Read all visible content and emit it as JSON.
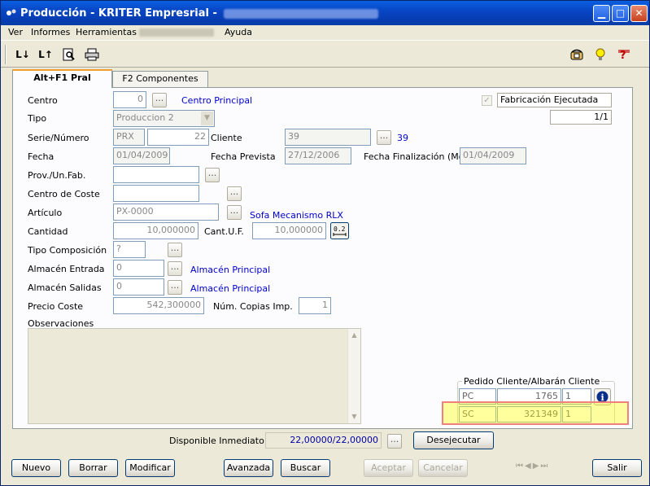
{
  "window": {
    "title": "Producción - KRITER Empresrial  -"
  },
  "menu": [
    "Ver",
    "Informes",
    "Herramientas",
    "Ayuda"
  ],
  "tabs": [
    {
      "label": "Alt+F1 Pral"
    },
    {
      "label": "F2 Componentes"
    }
  ],
  "toolbar": {
    "sort_asc": "L↓",
    "sort_desc": "L↑"
  },
  "form": {
    "centro": {
      "label": "Centro",
      "value": "0",
      "link": "Centro Principal"
    },
    "tipo": {
      "label": "Tipo",
      "value": "Produccion 2"
    },
    "fabricacion": {
      "label": "Fabricación Ejecutada",
      "counter": "1/1"
    },
    "serie": {
      "label": "Serie/Número",
      "serie": "PRX",
      "numero": "22"
    },
    "cliente": {
      "label": "Cliente",
      "value": "39",
      "link": "39"
    },
    "fecha": {
      "label": "Fecha",
      "value": "01/04/2009"
    },
    "fecha_prevista": {
      "label": "Fecha Prevista",
      "value": "27/12/2006"
    },
    "fecha_finalizacion": {
      "label": "Fecha Finalización (Mov.)",
      "value": "01/04/2009"
    },
    "prov": {
      "label": "Prov./Un.Fab.",
      "value": ""
    },
    "centro_coste": {
      "label": "Centro de Coste",
      "value": ""
    },
    "articulo": {
      "label": "Artículo",
      "value": "PX-0000",
      "link": "Sofa Mecanismo RLX"
    },
    "cantidad": {
      "label": "Cantidad",
      "value": "10,000000"
    },
    "cant_uf": {
      "label": "Cant.U.F.",
      "value": "10,000000"
    },
    "tipo_composicion": {
      "label": "Tipo Composición",
      "value": "?"
    },
    "almacen_entrada": {
      "label": "Almacén Entrada",
      "value": "0",
      "link": "Almacén Principal"
    },
    "almacen_salidas": {
      "label": "Almacén Salidas",
      "value": "0",
      "link": "Almacén Principal"
    },
    "precio_coste": {
      "label": "Precio Coste",
      "value": "542,300000"
    },
    "copias": {
      "label": "Núm. Copias Imp.",
      "value": "1"
    },
    "observaciones": {
      "label": "Observaciones",
      "value": ""
    }
  },
  "pedido": {
    "title": "Pedido Cliente/Albarán Cliente",
    "rows": [
      {
        "code": "PC",
        "number": "1765",
        "line": "1"
      },
      {
        "code": "SC",
        "number": "321349",
        "line": "1"
      }
    ]
  },
  "disponible": {
    "label": "Disponible Inmediato",
    "value": "22,00000/22,00000"
  },
  "buttons": {
    "desejecutar": "Desejecutar",
    "nuevo": "Nuevo",
    "borrar": "Borrar",
    "modificar": "Modificar",
    "avanzada": "Avanzada",
    "buscar": "Buscar",
    "aceptar": "Aceptar",
    "cancelar": "Cancelar",
    "salir": "Salir"
  },
  "dots": "..."
}
